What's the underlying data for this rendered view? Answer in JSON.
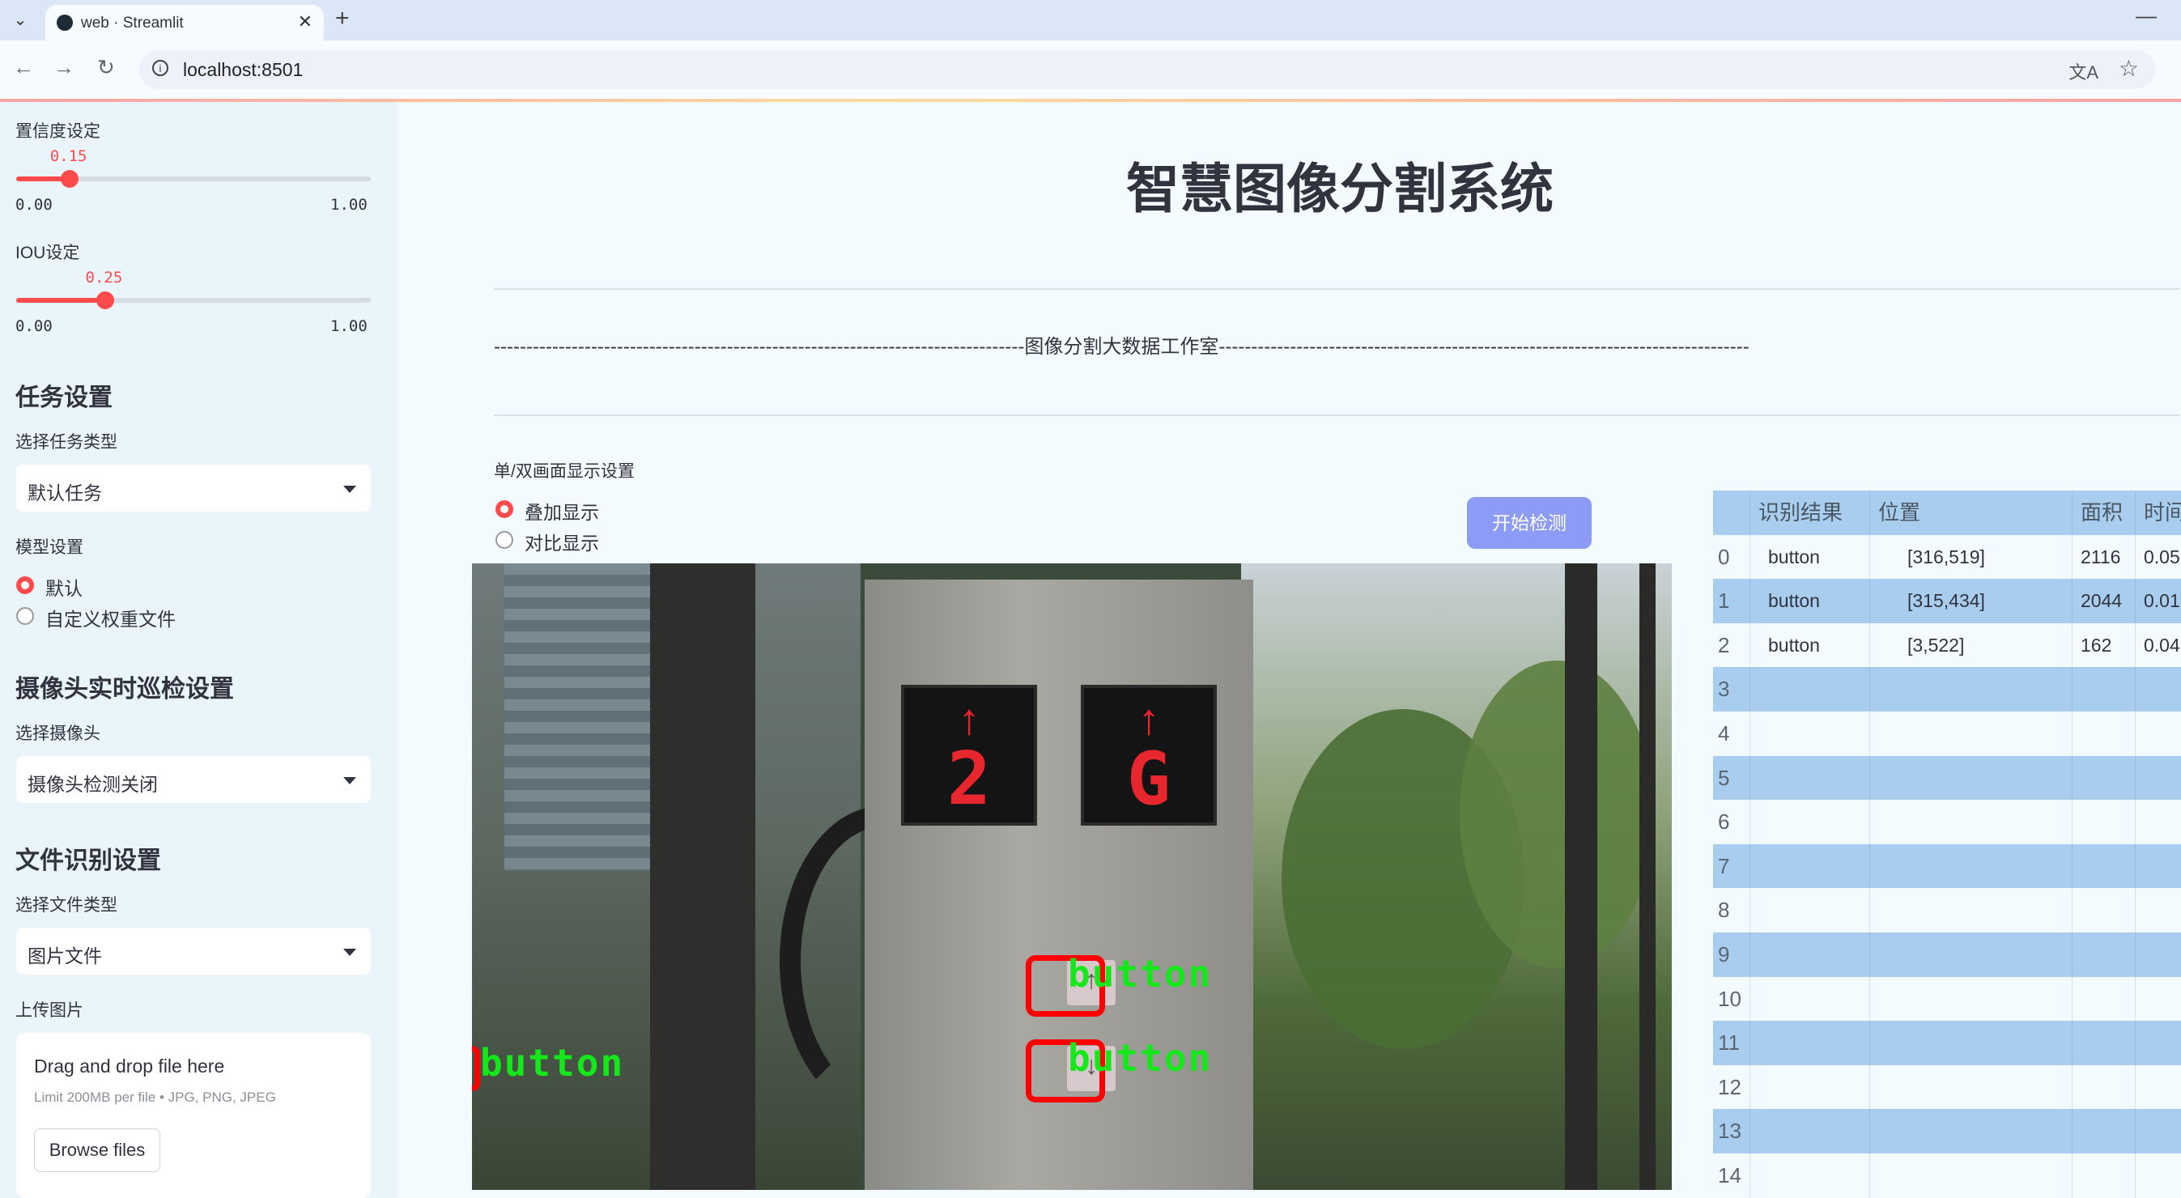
{
  "browser": {
    "tab_title": "web · Streamlit",
    "url": "localhost:8501"
  },
  "sidebar": {
    "confidence": {
      "label": "置信度设定",
      "value_text": "0.15",
      "value": 0.15,
      "min": "0.00",
      "max": "1.00"
    },
    "iou": {
      "label": "IOU设定",
      "value_text": "0.25",
      "value": 0.25,
      "min": "0.00",
      "max": "1.00"
    },
    "task_heading": "任务设置",
    "task_type_label": "选择任务类型",
    "task_type_value": "默认任务",
    "model_label": "模型设置",
    "model_options": [
      "默认",
      "自定义权重文件"
    ],
    "model_selected": 0,
    "camera_heading": "摄像头实时巡检设置",
    "camera_label": "选择摄像头",
    "camera_value": "摄像头检测关闭",
    "file_heading": "文件识别设置",
    "file_type_label": "选择文件类型",
    "file_type_value": "图片文件",
    "upload_label": "上传图片",
    "upload_title": "Drag and drop file here",
    "upload_limit": "Limit 200MB per file • JPG, PNG, JPEG",
    "browse_label": "Browse files"
  },
  "main": {
    "title": "智慧图像分割系统",
    "subtitle": "----------------------------------------------------------------------------------图像分割大数据工作室----------------------------------------------------------------------------------",
    "display_mode_label": "单/双画面显示设置",
    "display_modes": [
      "叠加显示",
      "对比显示"
    ],
    "display_selected": 0,
    "start_button": "开始检测"
  },
  "image": {
    "floor_displays": [
      {
        "arrow": "↑",
        "char": "2"
      },
      {
        "arrow": "↑",
        "char": "G"
      }
    ],
    "detections": [
      {
        "label": "button"
      },
      {
        "label": "button"
      },
      {
        "label": "button"
      }
    ]
  },
  "table": {
    "columns": [
      "",
      "识别结果",
      "位置",
      "面积",
      "时间"
    ],
    "rows": [
      {
        "index": "0",
        "result": "button",
        "position": "[316,519]",
        "area": "2116",
        "time": "0.05"
      },
      {
        "index": "1",
        "result": "button",
        "position": "[315,434]",
        "area": "2044",
        "time": "0.01"
      },
      {
        "index": "2",
        "result": "button",
        "position": "[3,522]",
        "area": "162",
        "time": "0.04"
      },
      {
        "index": "3",
        "result": "",
        "position": "",
        "area": "",
        "time": ""
      },
      {
        "index": "4",
        "result": "",
        "position": "",
        "area": "",
        "time": ""
      },
      {
        "index": "5",
        "result": "",
        "position": "",
        "area": "",
        "time": ""
      },
      {
        "index": "6",
        "result": "",
        "position": "",
        "area": "",
        "time": ""
      },
      {
        "index": "7",
        "result": "",
        "position": "",
        "area": "",
        "time": ""
      },
      {
        "index": "8",
        "result": "",
        "position": "",
        "area": "",
        "time": ""
      },
      {
        "index": "9",
        "result": "",
        "position": "",
        "area": "",
        "time": ""
      },
      {
        "index": "10",
        "result": "",
        "position": "",
        "area": "",
        "time": ""
      },
      {
        "index": "11",
        "result": "",
        "position": "",
        "area": "",
        "time": ""
      },
      {
        "index": "12",
        "result": "",
        "position": "",
        "area": "",
        "time": ""
      },
      {
        "index": "13",
        "result": "",
        "position": "",
        "area": "",
        "time": ""
      },
      {
        "index": "14",
        "result": "",
        "position": "",
        "area": "",
        "time": ""
      }
    ]
  },
  "colors": {
    "accent": "#ff4b4b",
    "sidebar_bg": "#eaf4fb",
    "button_bg": "#8c9bf5",
    "table_band": "#a8cdee",
    "detection_box": "#ff0000",
    "detection_text": "#14e81a"
  },
  "icons": [
    "tab-menu-icon",
    "streamlit-favicon",
    "close-icon",
    "plus-icon",
    "minimize-icon",
    "back-icon",
    "forward-icon",
    "reload-icon",
    "info-icon",
    "translate-icon",
    "star-icon",
    "chevron-down-icon"
  ]
}
